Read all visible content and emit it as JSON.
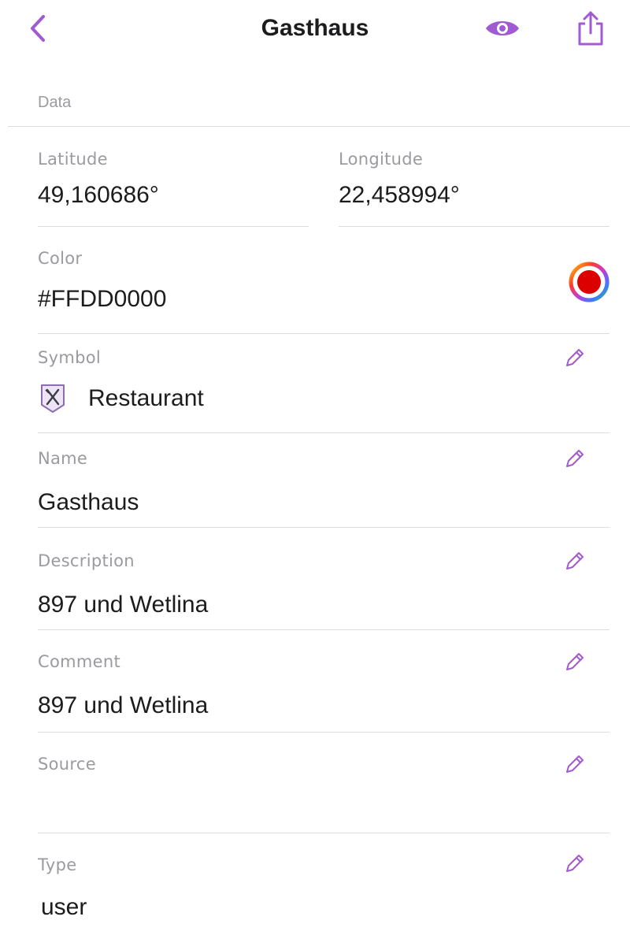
{
  "header": {
    "title": "Gasthaus",
    "icons": {
      "back": "chevron-left-icon",
      "visibility": "eye-icon",
      "share": "share-icon"
    }
  },
  "section": {
    "title": "Data"
  },
  "fields": {
    "latitude": {
      "label": "Latitude",
      "value": "49,160686°"
    },
    "longitude": {
      "label": "Longitude",
      "value": "22,458994°"
    },
    "color": {
      "label": "Color",
      "value": "#FFDD0000",
      "swatch_hex": "#dd0000"
    },
    "symbol": {
      "label": "Symbol",
      "value": "Restaurant",
      "icon": "restaurant-icon"
    },
    "name": {
      "label": "Name",
      "value": "Gasthaus"
    },
    "description": {
      "label": "Description",
      "value": "897 und Wetlina"
    },
    "comment": {
      "label": "Comment",
      "value": "897 und Wetlina"
    },
    "source": {
      "label": "Source",
      "value": ""
    },
    "type": {
      "label": "Type",
      "value": "user"
    }
  },
  "colors": {
    "accent": "#a05ad2",
    "label": "#9a9aa0",
    "divider": "#dcdce0",
    "text": "#1c1c1e"
  }
}
